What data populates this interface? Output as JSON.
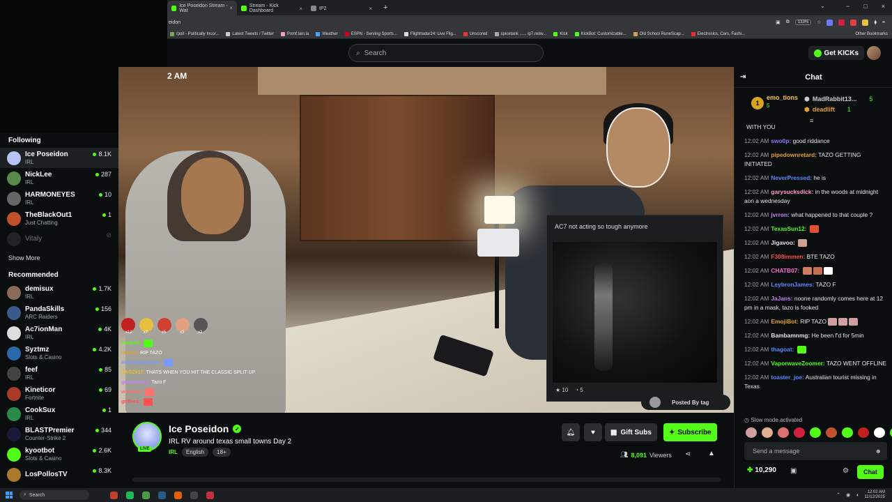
{
  "browser": {
    "tabs": [
      {
        "label": "Ice Poseidon Stream - Wat",
        "active": true,
        "color": "#53fc18"
      },
      {
        "label": "Stream - Kick Dashboard",
        "active": false,
        "color": "#53fc18"
      },
      {
        "label": "IP2",
        "active": false,
        "color": "#888888"
      }
    ],
    "new_tab": "+",
    "window_controls": [
      "−",
      "□",
      "×"
    ],
    "address": "eidon",
    "zoom": "133%",
    "bookmarks": [
      {
        "label": "/pol/ - Politically Incor...",
        "color": "#7aa85a"
      },
      {
        "label": "Latest Tweets / Twitter",
        "color": "#cccccc"
      },
      {
        "label": "Pomf.lain.la",
        "color": "#f0a0c0"
      },
      {
        "label": "Weather",
        "color": "#4aa3ff"
      },
      {
        "label": "ESPN - Serving Sports...",
        "color": "#d0021b"
      },
      {
        "label": "Flightradar24: Live Flig...",
        "color": "#dddddd"
      },
      {
        "label": "Unscored",
        "color": "#e33"
      },
      {
        "label": "spicetank ...... ip7.netw...",
        "color": "#aaaaaa"
      },
      {
        "label": "Kick",
        "color": "#53fc18"
      },
      {
        "label": "KickBot: Customizable...",
        "color": "#53fc18"
      },
      {
        "label": "Old School RuneScap...",
        "color": "#c9a34a"
      },
      {
        "label": "Electronics, Cars, Fashi...",
        "color": "#e53238"
      }
    ],
    "other_bookmarks": "Other Bookmarks"
  },
  "header": {
    "search_placeholder": "Search",
    "get_kicks": "Get KICKs"
  },
  "sidebar": {
    "following_title": "Following",
    "following": [
      {
        "name": "Ice Poseidon",
        "category": "IRL",
        "count": "8.1K",
        "color": "#b8c4f5",
        "active": true
      },
      {
        "name": "NickLee",
        "category": "IRL",
        "count": "287",
        "color": "#5a8a4a"
      },
      {
        "name": "HARMONEYES",
        "category": "IRL",
        "count": "10",
        "color": "#666666"
      },
      {
        "name": "TheBlackOut1",
        "category": "Just Chatting",
        "count": "1",
        "color": "#c0502a"
      },
      {
        "name": "Vitaly",
        "category": "",
        "count": "",
        "color": "#444444",
        "offline": true
      }
    ],
    "show_more": "Show More",
    "recommended_title": "Recommended",
    "recommended": [
      {
        "name": "demisux",
        "category": "IRL",
        "count": "1.7K",
        "color": "#8a6a5a"
      },
      {
        "name": "PandaSkills",
        "category": "ARC Raiders",
        "count": "156",
        "color": "#3a5a8a"
      },
      {
        "name": "Ac7ionMan",
        "category": "IRL",
        "count": "4K",
        "color": "#dddddd"
      },
      {
        "name": "Syztmz",
        "category": "Slots & Casino",
        "count": "4.2K",
        "color": "#2a6aaa"
      },
      {
        "name": "feef",
        "category": "IRL",
        "count": "85",
        "color": "#444444"
      },
      {
        "name": "Kineticor",
        "category": "Fortnite",
        "count": "69",
        "color": "#aa3a2a"
      },
      {
        "name": "CookSux",
        "category": "IRL",
        "count": "1",
        "color": "#2a8a4a"
      },
      {
        "name": "BLASTPremier",
        "category": "Counter-Strike 2",
        "count": "344",
        "color": "#1a1a3a"
      },
      {
        "name": "kyootbot",
        "category": "Slots & Casino",
        "count": "2.6K",
        "color": "#53fc18"
      },
      {
        "name": "LosPollosTV",
        "category": "",
        "count": "8.3K",
        "color": "#aa7a2a"
      }
    ]
  },
  "video": {
    "time_overlay": "2 AM",
    "alert_title": "AC7 not acting so tough anymore",
    "alert_stars": "10",
    "alert_count": "5",
    "posted_by": "Posted By tag",
    "overlay_chat": {
      "emotes": [
        {
          "count": "x12",
          "color": "#c02020"
        },
        {
          "count": "x7",
          "color": "#e6c040"
        },
        {
          "count": "x5",
          "color": "#d04030"
        },
        {
          "count": "x3",
          "color": "#e0a080"
        },
        {
          "count": "x2",
          "color": "#555555"
        }
      ],
      "lines": [
        {
          "user": "kimpski:",
          "text": "",
          "color": "#53fc18"
        },
        {
          "user": "rayoen:",
          "text": "RIP TAZO",
          "color": "#e0a030"
        },
        {
          "user": "kidfromparadise:",
          "text": "",
          "color": "#7a9aff"
        },
        {
          "user": "BAGZ617:",
          "text": "THATS WHEN YOU HIT THE CLASSIC SPLIT UP",
          "color": "#e0c030"
        },
        {
          "user": "gummyzerg:",
          "text": "Tazo F",
          "color": "#c080ff"
        },
        {
          "user": "westace:",
          "text": "",
          "color": "#ff7070"
        },
        {
          "user": "griffens:",
          "text": "",
          "color": "#ff5050"
        }
      ]
    }
  },
  "stream": {
    "streamer": "Ice Poseidon",
    "live": "LIVE",
    "title": "IRL RV around texas small towns Day 2",
    "category": "IRL",
    "tags": [
      "English",
      "18+"
    ],
    "gift_subs": "Gift Subs",
    "subscribe": "Subscribe",
    "viewers": "8,091",
    "viewers_label": "Viewers"
  },
  "chat": {
    "title": "Chat",
    "leaderboard": {
      "rank": "1",
      "top_user": "emo_tions",
      "top_count": "5",
      "others": [
        {
          "name": "MadRabbit13...",
          "count": "5",
          "color": "#cccccc"
        },
        {
          "name": "deadlift",
          "count": "1",
          "color": "#e6a030"
        }
      ]
    },
    "messages": [
      {
        "time": "",
        "user": "",
        "text": "WITH YOU",
        "color": "#ffffff"
      },
      {
        "time": "12:02 AM",
        "user": "swo0p:",
        "text": "good riddance",
        "color": "#8a7aff"
      },
      {
        "time": "12:02 AM",
        "user": "pipedownretard:",
        "text": "TAZO GETTING INITIATED",
        "color": "#e6a030"
      },
      {
        "time": "12:02 AM",
        "user": "NeverPressed:",
        "text": "he is",
        "color": "#5a8aff"
      },
      {
        "time": "12:02 AM",
        "user": "garysucksdick:",
        "text": "in the woods at midnight aon a wednesday",
        "color": "#ff9acd"
      },
      {
        "time": "12:02 AM",
        "user": "jvrron:",
        "text": "what happened to that couple ?",
        "color": "#c080ff"
      },
      {
        "time": "12:02 AM",
        "user": "TexasSun12:",
        "text": "",
        "color": "#53fc18",
        "emotes": [
          "#e05030"
        ]
      },
      {
        "time": "12:02 AM",
        "user": "Jigavoo:",
        "text": "",
        "color": "#e6e6e6",
        "emotes": [
          "#d0a090"
        ]
      },
      {
        "time": "12:02 AM",
        "user": "F308immen:",
        "text": "BTE TAZO",
        "color": "#ff4a4a"
      },
      {
        "time": "12:02 AM",
        "user": "CHATB07:",
        "text": "",
        "color": "#ff6ad0",
        "emotes": [
          "#d08060",
          "#c07050",
          "#ffffff"
        ]
      },
      {
        "time": "12:02 AM",
        "user": "LeybronJames:",
        "text": "TAZO F",
        "color": "#5a8aff"
      },
      {
        "time": "12:02 AM",
        "user": "JaJans:",
        "text": "noone randomly comes here at 12 pm in a mask, tazo is fooked",
        "color": "#c080ff"
      },
      {
        "time": "12:02 AM",
        "user": "EmojiBot:",
        "text": "RIP TAZO",
        "color": "#e6a030",
        "emotes": [
          "#d0a0a0",
          "#d0a0a0",
          "#d0a0a0"
        ]
      },
      {
        "time": "12:02 AM",
        "user": "Bambamnmg:",
        "text": "He been f'd for 5min",
        "color": "#e6e6e6"
      },
      {
        "time": "12:02 AM",
        "user": "thagoat:",
        "text": "",
        "color": "#5a8aff",
        "emotes": [
          "#53fc18"
        ]
      },
      {
        "time": "12:02 AM",
        "user": "VaporwaveZoomer:",
        "text": "TAZO WENT OFFLINE",
        "color": "#53fc18"
      },
      {
        "time": "12:02 AM",
        "user": "toaster_joe:",
        "text": "Australian tourist missing in Texas",
        "color": "#5a8aff"
      }
    ],
    "slow_mode": "Slow mode activated",
    "emote_bar": [
      "#d0a0a0",
      "#e0b090",
      "#e07070",
      "#d02040",
      "#53fc18",
      "#c05030",
      "#53fc18",
      "#c02020",
      "#ffffff",
      "#53fc18",
      "#53fc18",
      "#53fc18"
    ],
    "input_placeholder": "Send a message",
    "points": "10,290",
    "chat_button": "Chat"
  },
  "taskbar": {
    "search": "Search",
    "time": "12:02 AM",
    "date": "11/12/2025"
  }
}
